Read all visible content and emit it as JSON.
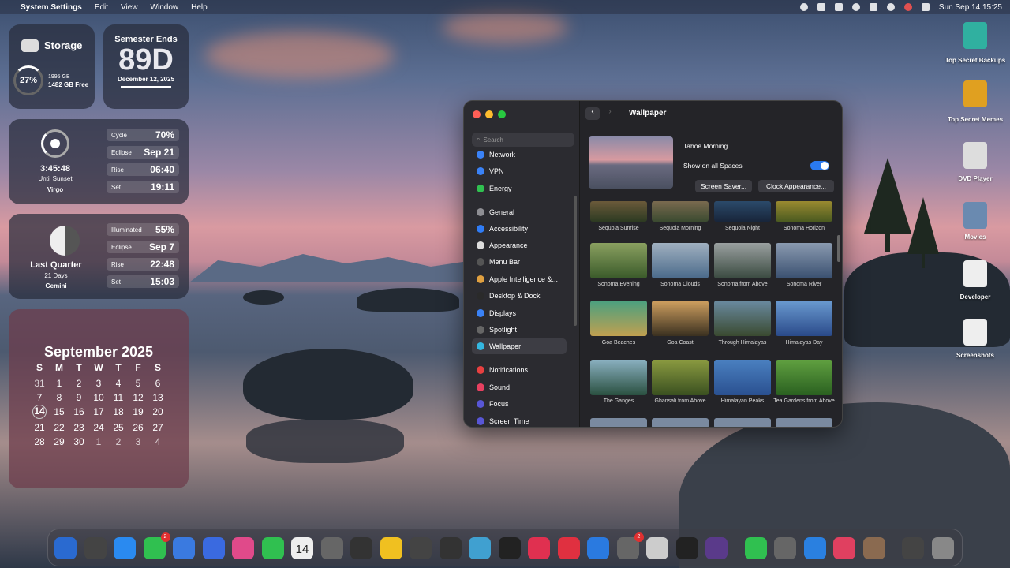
{
  "menubar": {
    "apple": "",
    "app": "System Settings",
    "items": [
      "Edit",
      "View",
      "Window",
      "Help"
    ],
    "clock": "Sun Sep 14  15:25"
  },
  "storage": {
    "title": "Storage",
    "percent": "27%",
    "line1": "1995 GB",
    "line2": "1482 GB Free"
  },
  "semester": {
    "title": "Semester Ends",
    "days": "89D",
    "date": "December 12, 2025"
  },
  "sun": {
    "time": "3:45:48",
    "sub": "Until Sunset",
    "sign": "Virgo",
    "rows": [
      {
        "k": "Cycle",
        "v": "70%"
      },
      {
        "k": "Eclipse",
        "v": "Sep 21"
      },
      {
        "k": "Rise",
        "v": "06:40"
      },
      {
        "k": "Set",
        "v": "19:11"
      }
    ]
  },
  "moon": {
    "phase": "Last Quarter",
    "days": "21 Days",
    "sign": "Gemini",
    "rows": [
      {
        "k": "Illuminated",
        "v": "55%"
      },
      {
        "k": "Eclipse",
        "v": "Sep 7"
      },
      {
        "k": "Rise",
        "v": "22:48"
      },
      {
        "k": "Set",
        "v": "15:03"
      }
    ]
  },
  "calendar": {
    "title": "September 2025",
    "weekdays": [
      "S",
      "M",
      "T",
      "W",
      "T",
      "F",
      "S"
    ],
    "days": [
      "31",
      "1",
      "2",
      "3",
      "4",
      "5",
      "6",
      "7",
      "8",
      "9",
      "10",
      "11",
      "12",
      "13",
      "14",
      "15",
      "16",
      "17",
      "18",
      "19",
      "20",
      "21",
      "22",
      "23",
      "24",
      "25",
      "26",
      "27",
      "28",
      "29",
      "30",
      "1",
      "2",
      "3",
      "4"
    ],
    "today": "14"
  },
  "settings": {
    "search_placeholder": "Search",
    "sidebar": [
      {
        "label": "Network",
        "color": "#3a82f7"
      },
      {
        "label": "VPN",
        "color": "#3a82f7"
      },
      {
        "label": "Energy",
        "color": "#30c050"
      },
      {
        "label": "General",
        "color": "#8e8e93"
      },
      {
        "label": "Accessibility",
        "color": "#2f7cf6"
      },
      {
        "label": "Appearance",
        "color": "#ddd"
      },
      {
        "label": "Menu Bar",
        "color": "#555"
      },
      {
        "label": "Apple Intelligence &...",
        "color": "#e0a040"
      },
      {
        "label": "Desktop & Dock",
        "color": "#2a2a2a"
      },
      {
        "label": "Displays",
        "color": "#3a82f7"
      },
      {
        "label": "Spotlight",
        "color": "#666"
      },
      {
        "label": "Wallpaper",
        "color": "#34b7e0"
      },
      {
        "label": "Notifications",
        "color": "#e84040"
      },
      {
        "label": "Sound",
        "color": "#e84060"
      },
      {
        "label": "Focus",
        "color": "#5856d6"
      },
      {
        "label": "Screen Time",
        "color": "#5856d6"
      }
    ],
    "title": "Wallpaper",
    "current": "Tahoe Morning",
    "show_all": "Show on all Spaces",
    "btn_saver": "Screen Saver...",
    "btn_clock": "Clock Appearance...",
    "thumbs": [
      {
        "label": "Sequoia Sunrise",
        "c1": "#6b5a3a",
        "c2": "#2c3a22"
      },
      {
        "label": "Sequoia Morning",
        "c1": "#7a6a4f",
        "c2": "#3a4a30"
      },
      {
        "label": "Sequoia Night",
        "c1": "#2b4a6a",
        "c2": "#18253a"
      },
      {
        "label": "Sonoma Horizon",
        "c1": "#9a8a30",
        "c2": "#4a5a20"
      },
      {
        "label": "Sonoma Evening",
        "c1": "#8aa060",
        "c2": "#3a5a2a"
      },
      {
        "label": "Sonoma Clouds",
        "c1": "#a0b0c0",
        "c2": "#4a6a8a"
      },
      {
        "label": "Sonoma from Above",
        "c1": "#9aa0a0",
        "c2": "#3a4a40"
      },
      {
        "label": "Sonoma River",
        "c1": "#8a9ab0",
        "c2": "#3a5070"
      },
      {
        "label": "Goa Beaches",
        "c1": "#4aa080",
        "c2": "#c0a050"
      },
      {
        "label": "Goa Coast",
        "c1": "#d0a060",
        "c2": "#3a3020"
      },
      {
        "label": "Through Himalayas",
        "c1": "#6a8aa0",
        "c2": "#3a4a30"
      },
      {
        "label": "Himalayas Day",
        "c1": "#6a9ad0",
        "c2": "#2a4a8a"
      },
      {
        "label": "The Ganges",
        "c1": "#8ab0c0",
        "c2": "#2a5040"
      },
      {
        "label": "Ghansali from Above",
        "c1": "#8a9a40",
        "c2": "#3a5020"
      },
      {
        "label": "Himalayan Peaks",
        "c1": "#4a80c0",
        "c2": "#2a5090"
      },
      {
        "label": "Tea Gardens from Above",
        "c1": "#60a040",
        "c2": "#2a6020"
      }
    ]
  },
  "desktop": [
    {
      "label": "Top Secret Backups",
      "color": "#30b0a0"
    },
    {
      "label": "Top Secret Memes",
      "color": "#e0a020"
    },
    {
      "label": "DVD Player",
      "color": "#ddd"
    },
    {
      "label": "Movies",
      "color": "#6a8ab0"
    },
    {
      "label": "Developer",
      "color": "#eee"
    },
    {
      "label": "Screenshots",
      "color": "#eee"
    }
  ],
  "dock": {
    "colors": [
      "#2a6ad0",
      "#444",
      "#2a8af0",
      "#30c050",
      "#3a7ae0",
      "#3a6ae0",
      "#e04a8a",
      "#30c050",
      "#eee",
      "#666",
      "#333",
      "#f0c020",
      "#444",
      "#333",
      "#40a0d0",
      "#222",
      "#e03050",
      "#e03040",
      "#2a7ae0",
      "#666",
      "#ccc",
      "#222",
      "#5a3a8a",
      "#30c050",
      "#666",
      "#2a80e0",
      "#e04060",
      "#8a6a50",
      "#444",
      "#888"
    ],
    "badge_messages": "2",
    "badge_settings": "2",
    "calendar_day": "14"
  }
}
